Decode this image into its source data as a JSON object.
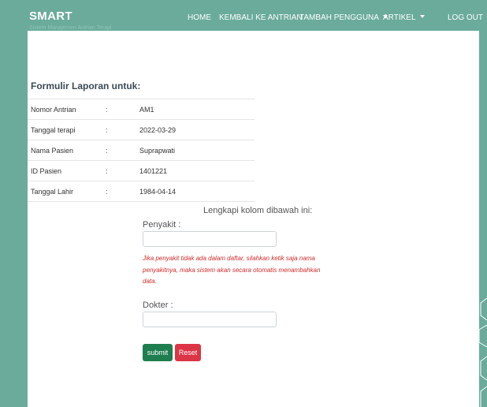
{
  "navbar": {
    "brand": "SMART",
    "brand_sub": "Sistem Manajemen Antrian Terapi",
    "links": {
      "home": "HOME",
      "back_to_queue": "KEMBALI KE ANTRIAN",
      "add_user": "TAMBAH PENGGUNA",
      "article": "ARTIKEL",
      "logout": "LOG OUT"
    }
  },
  "form": {
    "title": "Formulir Laporan untuk:",
    "rows": [
      {
        "label": "Nomor Antrian",
        "colon": ":",
        "value": "AM1"
      },
      {
        "label": "Tanggal terapi",
        "colon": ":",
        "value": "2022-03-29"
      },
      {
        "label": "Nama Pasien",
        "colon": ":",
        "value": "Suprapwati"
      },
      {
        "label": "ID Pasien",
        "colon": ":",
        "value": "1401221"
      },
      {
        "label": "Tanggal Lahir",
        "colon": ":",
        "value": "1984-04-14"
      }
    ],
    "instruction": "Lengkapi kolom dibawah ini:",
    "disease_label": "Penyakit :",
    "disease_value": "",
    "note": "Jika penyakit tidak ada dalam daftar, silahkan ketik saja nama penyakitnya, maka sistem akan secara otomatis menambahkan data.",
    "doctor_label": "Dokter :",
    "doctor_value": "",
    "submit_label": "submit",
    "reset_label": "Reset"
  },
  "colors": {
    "background": "#6aab9c",
    "submit": "#1e7e4f",
    "reset": "#dc3545",
    "note": "#d12b2b"
  }
}
